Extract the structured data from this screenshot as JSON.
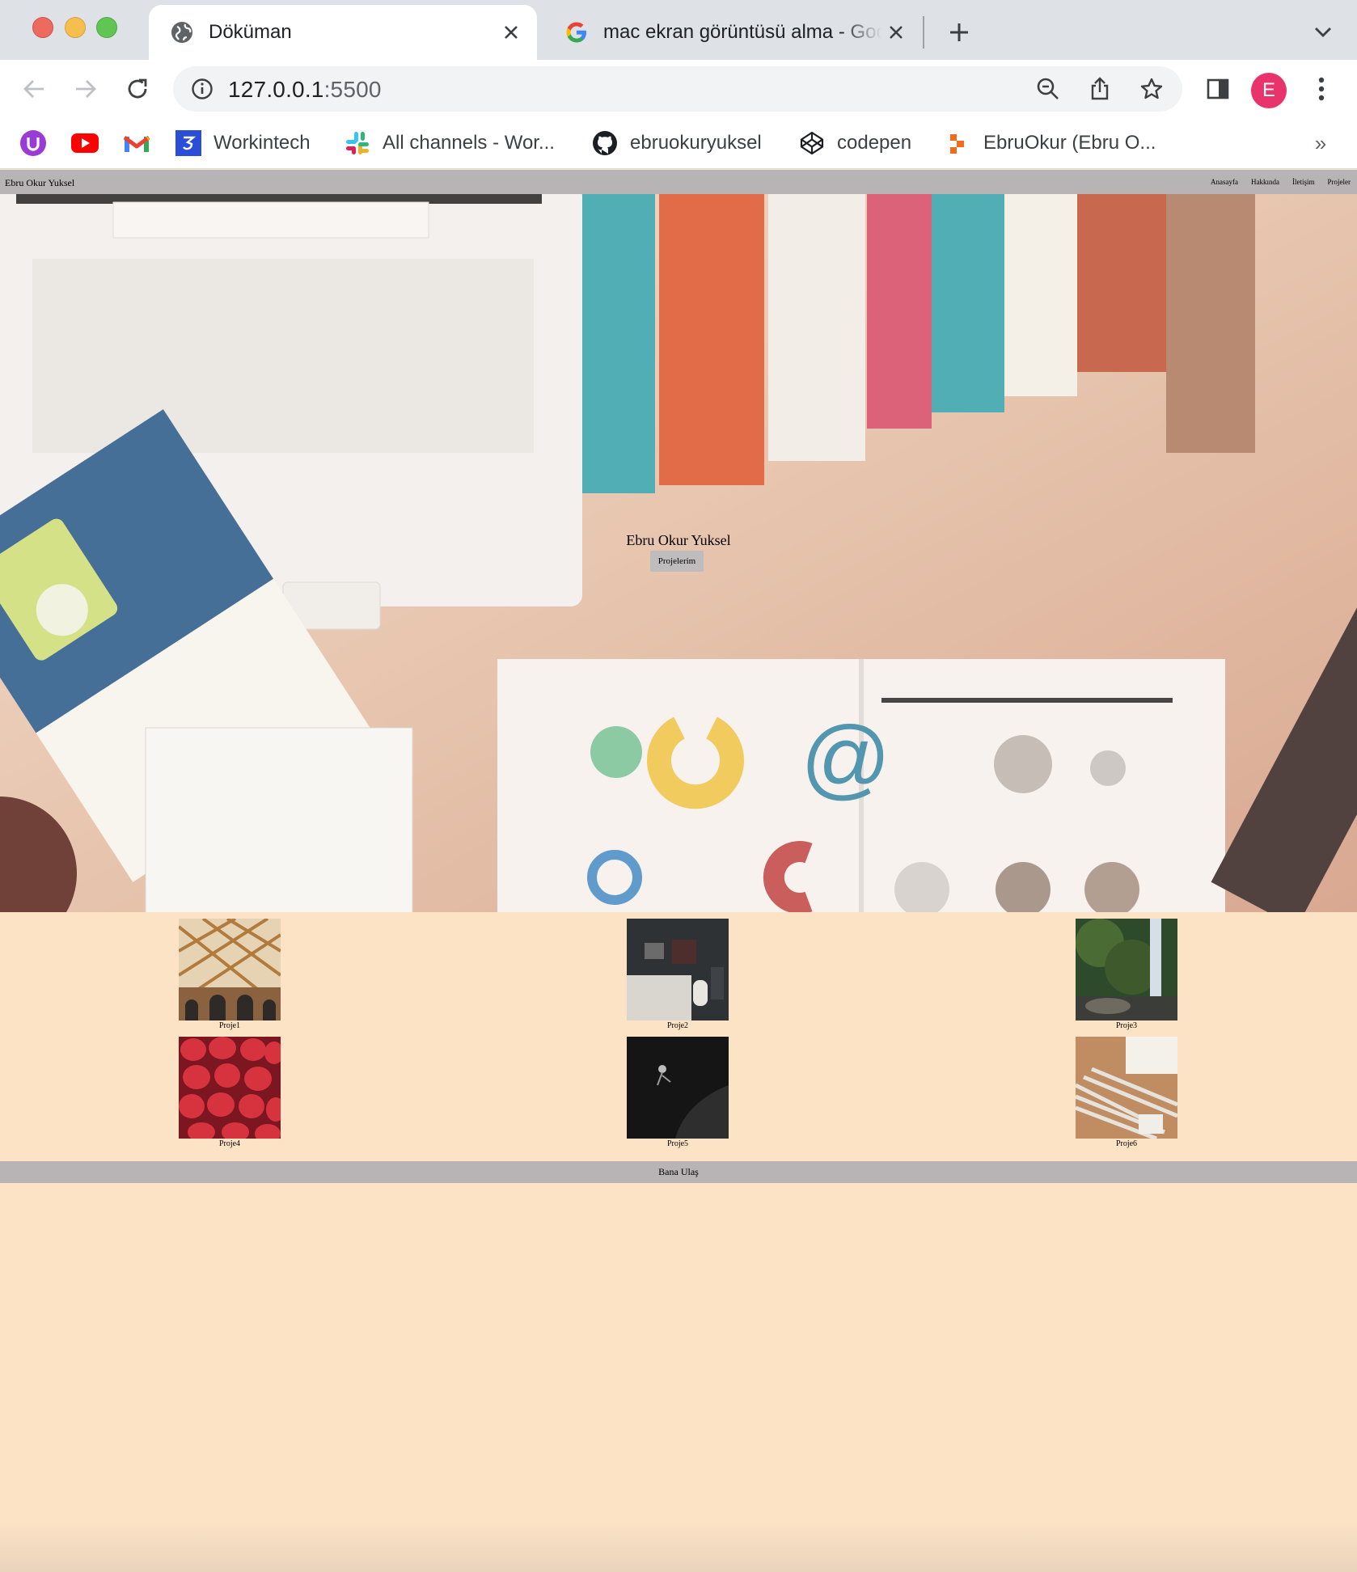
{
  "browser": {
    "tabs": [
      {
        "title": "Döküman",
        "active": true,
        "favicon": "globe-icon"
      },
      {
        "title": "mac ekran görüntüsü alma - Google",
        "active": false,
        "favicon": "google-icon"
      }
    ],
    "address": {
      "host": "127.0.0.1",
      "port": ":5500"
    },
    "profile_initial": "E",
    "bookmarks": [
      {
        "label": "",
        "icon": "u-icon"
      },
      {
        "label": "",
        "icon": "youtube-icon"
      },
      {
        "label": "",
        "icon": "gmail-icon"
      },
      {
        "label": "Workintech",
        "icon": "workintech-icon"
      },
      {
        "label": "All channels - Wor...",
        "icon": "slack-icon"
      },
      {
        "label": "ebruokuryuksel",
        "icon": "github-icon"
      },
      {
        "label": "codepen",
        "icon": "codepen-icon"
      },
      {
        "label": "EbruOkur (Ebru O...",
        "icon": "bookmark-icon"
      }
    ],
    "bookmarks_more": "»"
  },
  "site": {
    "brand": "Ebru Okur Yuksel",
    "nav": [
      "Anasayfa",
      "Hakkında",
      "İletişim",
      "Projeler"
    ],
    "hero": {
      "name": "Ebru Okur Yuksel",
      "button": "Projelerim"
    },
    "projects": [
      "Proje1",
      "Proje2",
      "Proje3",
      "Proje4",
      "Proje5",
      "Proje6"
    ],
    "footer": "Bana Ulaş"
  },
  "colors": {
    "page_bg": "#fde3c6",
    "nav_bg": "#b8b3b5",
    "profile": "#e8336d"
  }
}
